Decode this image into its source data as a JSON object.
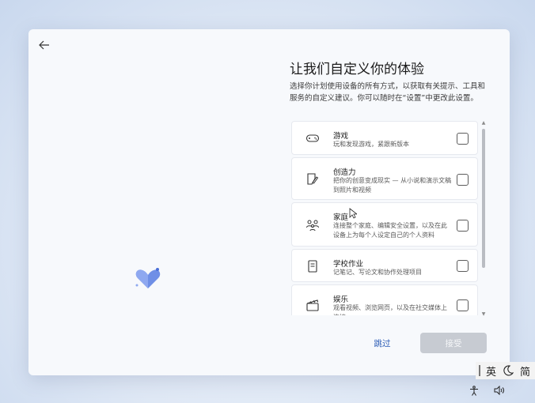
{
  "title": "让我们自定义你的体验",
  "description": "选择你计划使用设备的所有方式，以获取有关提示、工具和服务的自定义建议。你可以随时在“设置”中更改此设置。",
  "options": [
    {
      "icon": "gamepad-icon",
      "name": "游戏",
      "sub": "玩和发现游戏，紧跟新版本",
      "checked": false
    },
    {
      "icon": "creativity-icon",
      "name": "创造力",
      "sub": "把你的创意变成现实 — 从小说和演示文稿到照片和视频",
      "checked": false
    },
    {
      "icon": "family-icon",
      "name": "家庭",
      "sub": "连接整个家庭、编辑安全设置，以及在此设备上为每个人设定自己的个人资料",
      "checked": false
    },
    {
      "icon": "schoolwork-icon",
      "name": "学校作业",
      "sub": "记笔记、写论文和协作处理项目",
      "checked": false
    },
    {
      "icon": "entertainment-icon",
      "name": "娱乐",
      "sub": "观看视频、浏览网页，以及在社交媒体上连接",
      "checked": false
    }
  ],
  "buttons": {
    "skip": "跳过",
    "accept": "接受"
  },
  "ime": {
    "lang": "英",
    "mode": "简"
  },
  "colors": {
    "accent": "#2a5bb5",
    "heart": "#6f8fe6",
    "disabled_button": "#c7cbd2"
  }
}
